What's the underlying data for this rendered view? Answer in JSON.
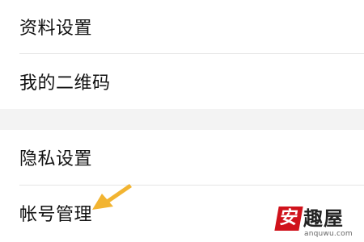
{
  "settings": {
    "section1": [
      {
        "label": "资料设置"
      },
      {
        "label": "我的二维码"
      }
    ],
    "section2": [
      {
        "label": "隐私设置"
      },
      {
        "label": "帐号管理"
      }
    ]
  },
  "annotation": {
    "arrow_color": "#f2b431",
    "arrow_target": "帐号管理"
  },
  "watermark": {
    "char_red": "安",
    "rest": "趣屋",
    "url": "anquwu.com",
    "brand_color": "#d0121b"
  },
  "colors": {
    "background": "#ffffff",
    "divider": "#e5e5e5",
    "section_gap": "#f3f3f3",
    "text": "#111111"
  }
}
